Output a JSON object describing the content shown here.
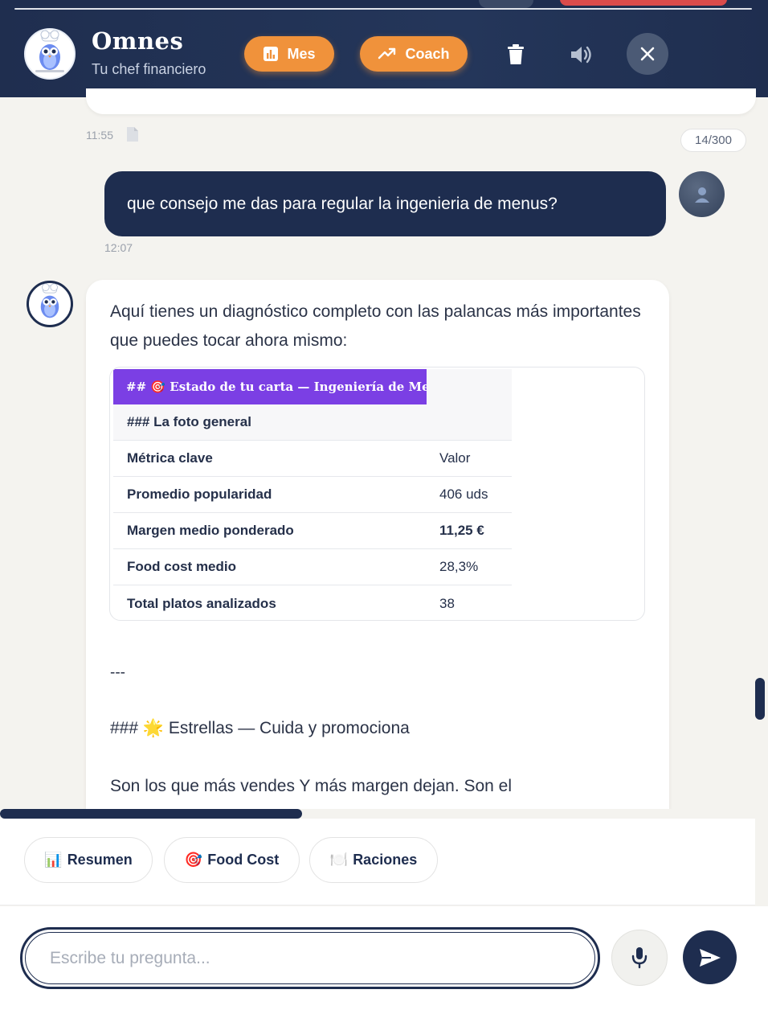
{
  "header": {
    "title": "Omnes",
    "subtitle": "Tu chef financiero",
    "mes_label": "Mes",
    "coach_label": "Coach"
  },
  "chat": {
    "prev_timestamp": "11:55",
    "char_counter": "14/300",
    "user_message": "que consejo me das para regular la ingenieria de menus?",
    "user_timestamp": "12:07",
    "bot": {
      "intro": "Aquí tienes un diagnóstico completo con las palancas más importantes que puedes tocar ahora mismo:",
      "table": {
        "header": "## 🎯 Estado de tu carta — Ingeniería de Menú",
        "subheader": "### La foto general",
        "columns": [
          "Métrica clave",
          "Valor"
        ],
        "rows": [
          {
            "metric": "Promedio popularidad",
            "value": "406 uds"
          },
          {
            "metric": "Margen medio ponderado",
            "value": "11,25 €"
          },
          {
            "metric": "Food cost medio",
            "value": "28,3%"
          },
          {
            "metric": "Total platos analizados",
            "value": "38"
          }
        ]
      },
      "separator": "---",
      "section_heading": "### 🌟 Estrellas — Cuida y promociona",
      "trailing_text": "Son los que más vendes Y más margen dejan. Son el"
    }
  },
  "quick_actions": [
    {
      "emoji": "📊",
      "label": "Resumen"
    },
    {
      "emoji": "🎯",
      "label": "Food Cost"
    },
    {
      "emoji": "🍽️",
      "label": "Raciones"
    }
  ],
  "input": {
    "placeholder": "Escribe tu pregunta...",
    "value": ""
  },
  "colors": {
    "navy": "#1e2d4f",
    "accent_orange": "#f0923b",
    "table_header_purple": "#7b3fe4"
  }
}
